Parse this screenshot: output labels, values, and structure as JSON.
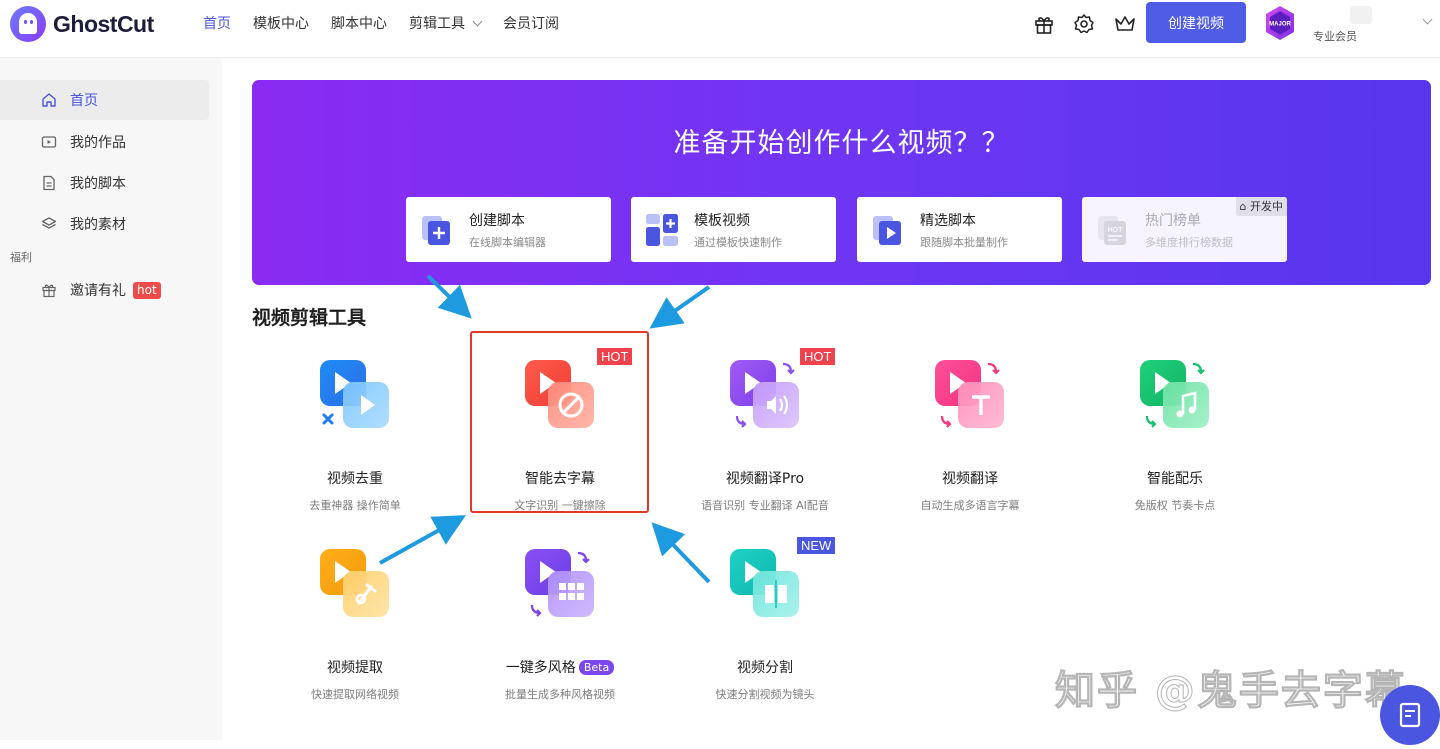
{
  "header": {
    "logo_text": "GhostCut",
    "nav": [
      {
        "label": "首页"
      },
      {
        "label": "模板中心"
      },
      {
        "label": "脚本中心"
      },
      {
        "label": "剪辑工具"
      },
      {
        "label": "会员订阅"
      }
    ],
    "create_button": "创建视频",
    "avatar_badge": "MAJOR",
    "member_label": "专业会员",
    "icons": [
      "gift-icon",
      "gear-icon",
      "crown-icon"
    ]
  },
  "sidebar": {
    "items": [
      {
        "label": "首页",
        "icon": "home-icon"
      },
      {
        "label": "我的作品",
        "icon": "video-icon"
      },
      {
        "label": "我的脚本",
        "icon": "document-icon"
      },
      {
        "label": "我的素材",
        "icon": "layers-icon"
      }
    ],
    "group_label": "福利",
    "invite": {
      "label": "邀请有礼",
      "badge": "hot",
      "icon": "gift-icon"
    }
  },
  "banner": {
    "title": "准备开始创作什么视频？？",
    "cards": [
      {
        "title": "创建脚本",
        "subtitle": "在线脚本编辑器"
      },
      {
        "title": "模板视频",
        "subtitle": "通过模板快速制作"
      },
      {
        "title": "精选脚本",
        "subtitle": "跟随脚本批量制作"
      },
      {
        "title": "热门榜单",
        "subtitle": "多维度排行榜数据",
        "status": "开发中",
        "hot_icon_text": "HOT"
      }
    ]
  },
  "section_title": "视频剪辑工具",
  "tools": [
    {
      "name": "视频去重",
      "subtitle": "去重神器 操作简单"
    },
    {
      "name": "智能去字幕",
      "subtitle": "文字识别 一键擦除",
      "tag": "HOT"
    },
    {
      "name": "视频翻译Pro",
      "subtitle": "语音识别 专业翻译 AI配音",
      "tag": "HOT"
    },
    {
      "name": "视频翻译",
      "subtitle": "自动生成多语言字幕"
    },
    {
      "name": "智能配乐",
      "subtitle": "免版权 节奏卡点"
    },
    {
      "name": "视频提取",
      "subtitle": "快速提取网络视频"
    },
    {
      "name": "一键多风格",
      "subtitle": "批量生成多种风格视频",
      "badge": "Beta"
    },
    {
      "name": "视频分割",
      "subtitle": "快速分割视频为镜头",
      "tag": "NEW"
    }
  ],
  "watermark": "知乎 @鬼手去字幕",
  "colors": {
    "accent": "#4f5ce6",
    "banner_start": "#8a2bf2",
    "banner_end": "#5736ee",
    "hot": "#f0424c",
    "highlight": "#e0392a",
    "arrow": "#1e9be0"
  }
}
